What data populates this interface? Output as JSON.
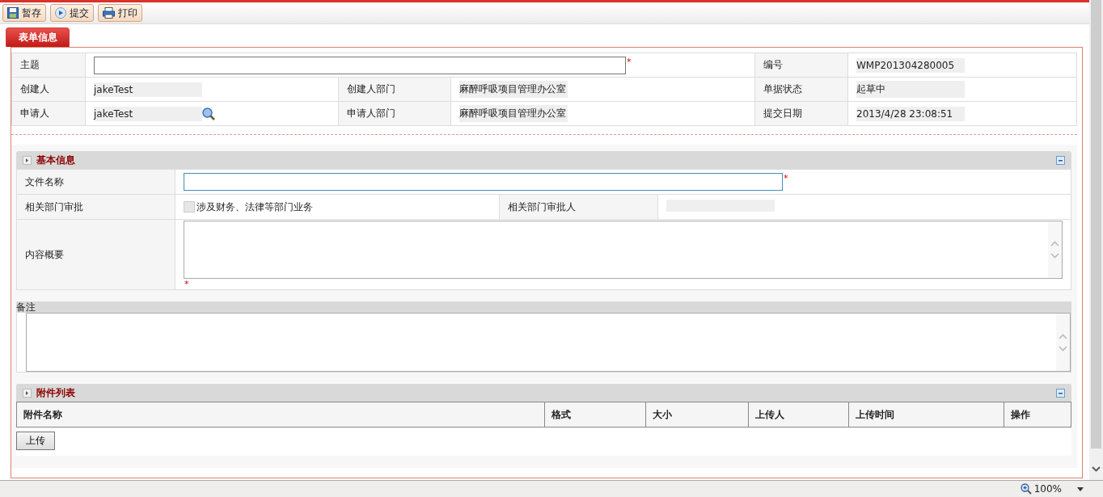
{
  "toolbar": [
    {
      "label": "暂存",
      "kind": "save"
    },
    {
      "label": "提交",
      "kind": "submit"
    },
    {
      "label": "打印",
      "kind": "print"
    }
  ],
  "tabs": [
    {
      "label": "表单信息",
      "selected": true
    }
  ],
  "header": {
    "subject": {
      "label": "主题",
      "required_mark": "*"
    },
    "number": {
      "label": "编号",
      "value": "WMP201304280005"
    },
    "rows": [
      [
        {
          "label": "创建人",
          "value": "jakeTest",
          "lookup": false
        },
        {
          "label": "创建人部门",
          "value": "麻醉呼吸项目管理办公室"
        },
        {
          "label": "单据状态",
          "value": "起草中"
        }
      ],
      [
        {
          "label": "申请人",
          "value": "jakeTest",
          "lookup": true
        },
        {
          "label": "申请人部门",
          "value": "麻醉呼吸项目管理办公室"
        },
        {
          "label": "提交日期",
          "value": "2013/4/28 23:08:51"
        }
      ]
    ]
  },
  "basic_info": {
    "title": "基本信息",
    "file_name": {
      "label": "文件名称",
      "required_mark": "*"
    },
    "dept_approval": {
      "label": "相关部门审批",
      "checkbox": {
        "label": "涉及财务、法律等部门业务",
        "checked": false
      },
      "approver_label": "相关部门审批人"
    },
    "summary": {
      "label": "内容概要",
      "required_mark": "*"
    }
  },
  "remarks": {
    "label": "备注"
  },
  "attachments": {
    "title": "附件列表",
    "columns": [
      "附件名称",
      "格式",
      "大小",
      "上传人",
      "上传时间",
      "操作"
    ],
    "upload_button": "上传"
  },
  "status_bar": {
    "zoom": "100%"
  }
}
